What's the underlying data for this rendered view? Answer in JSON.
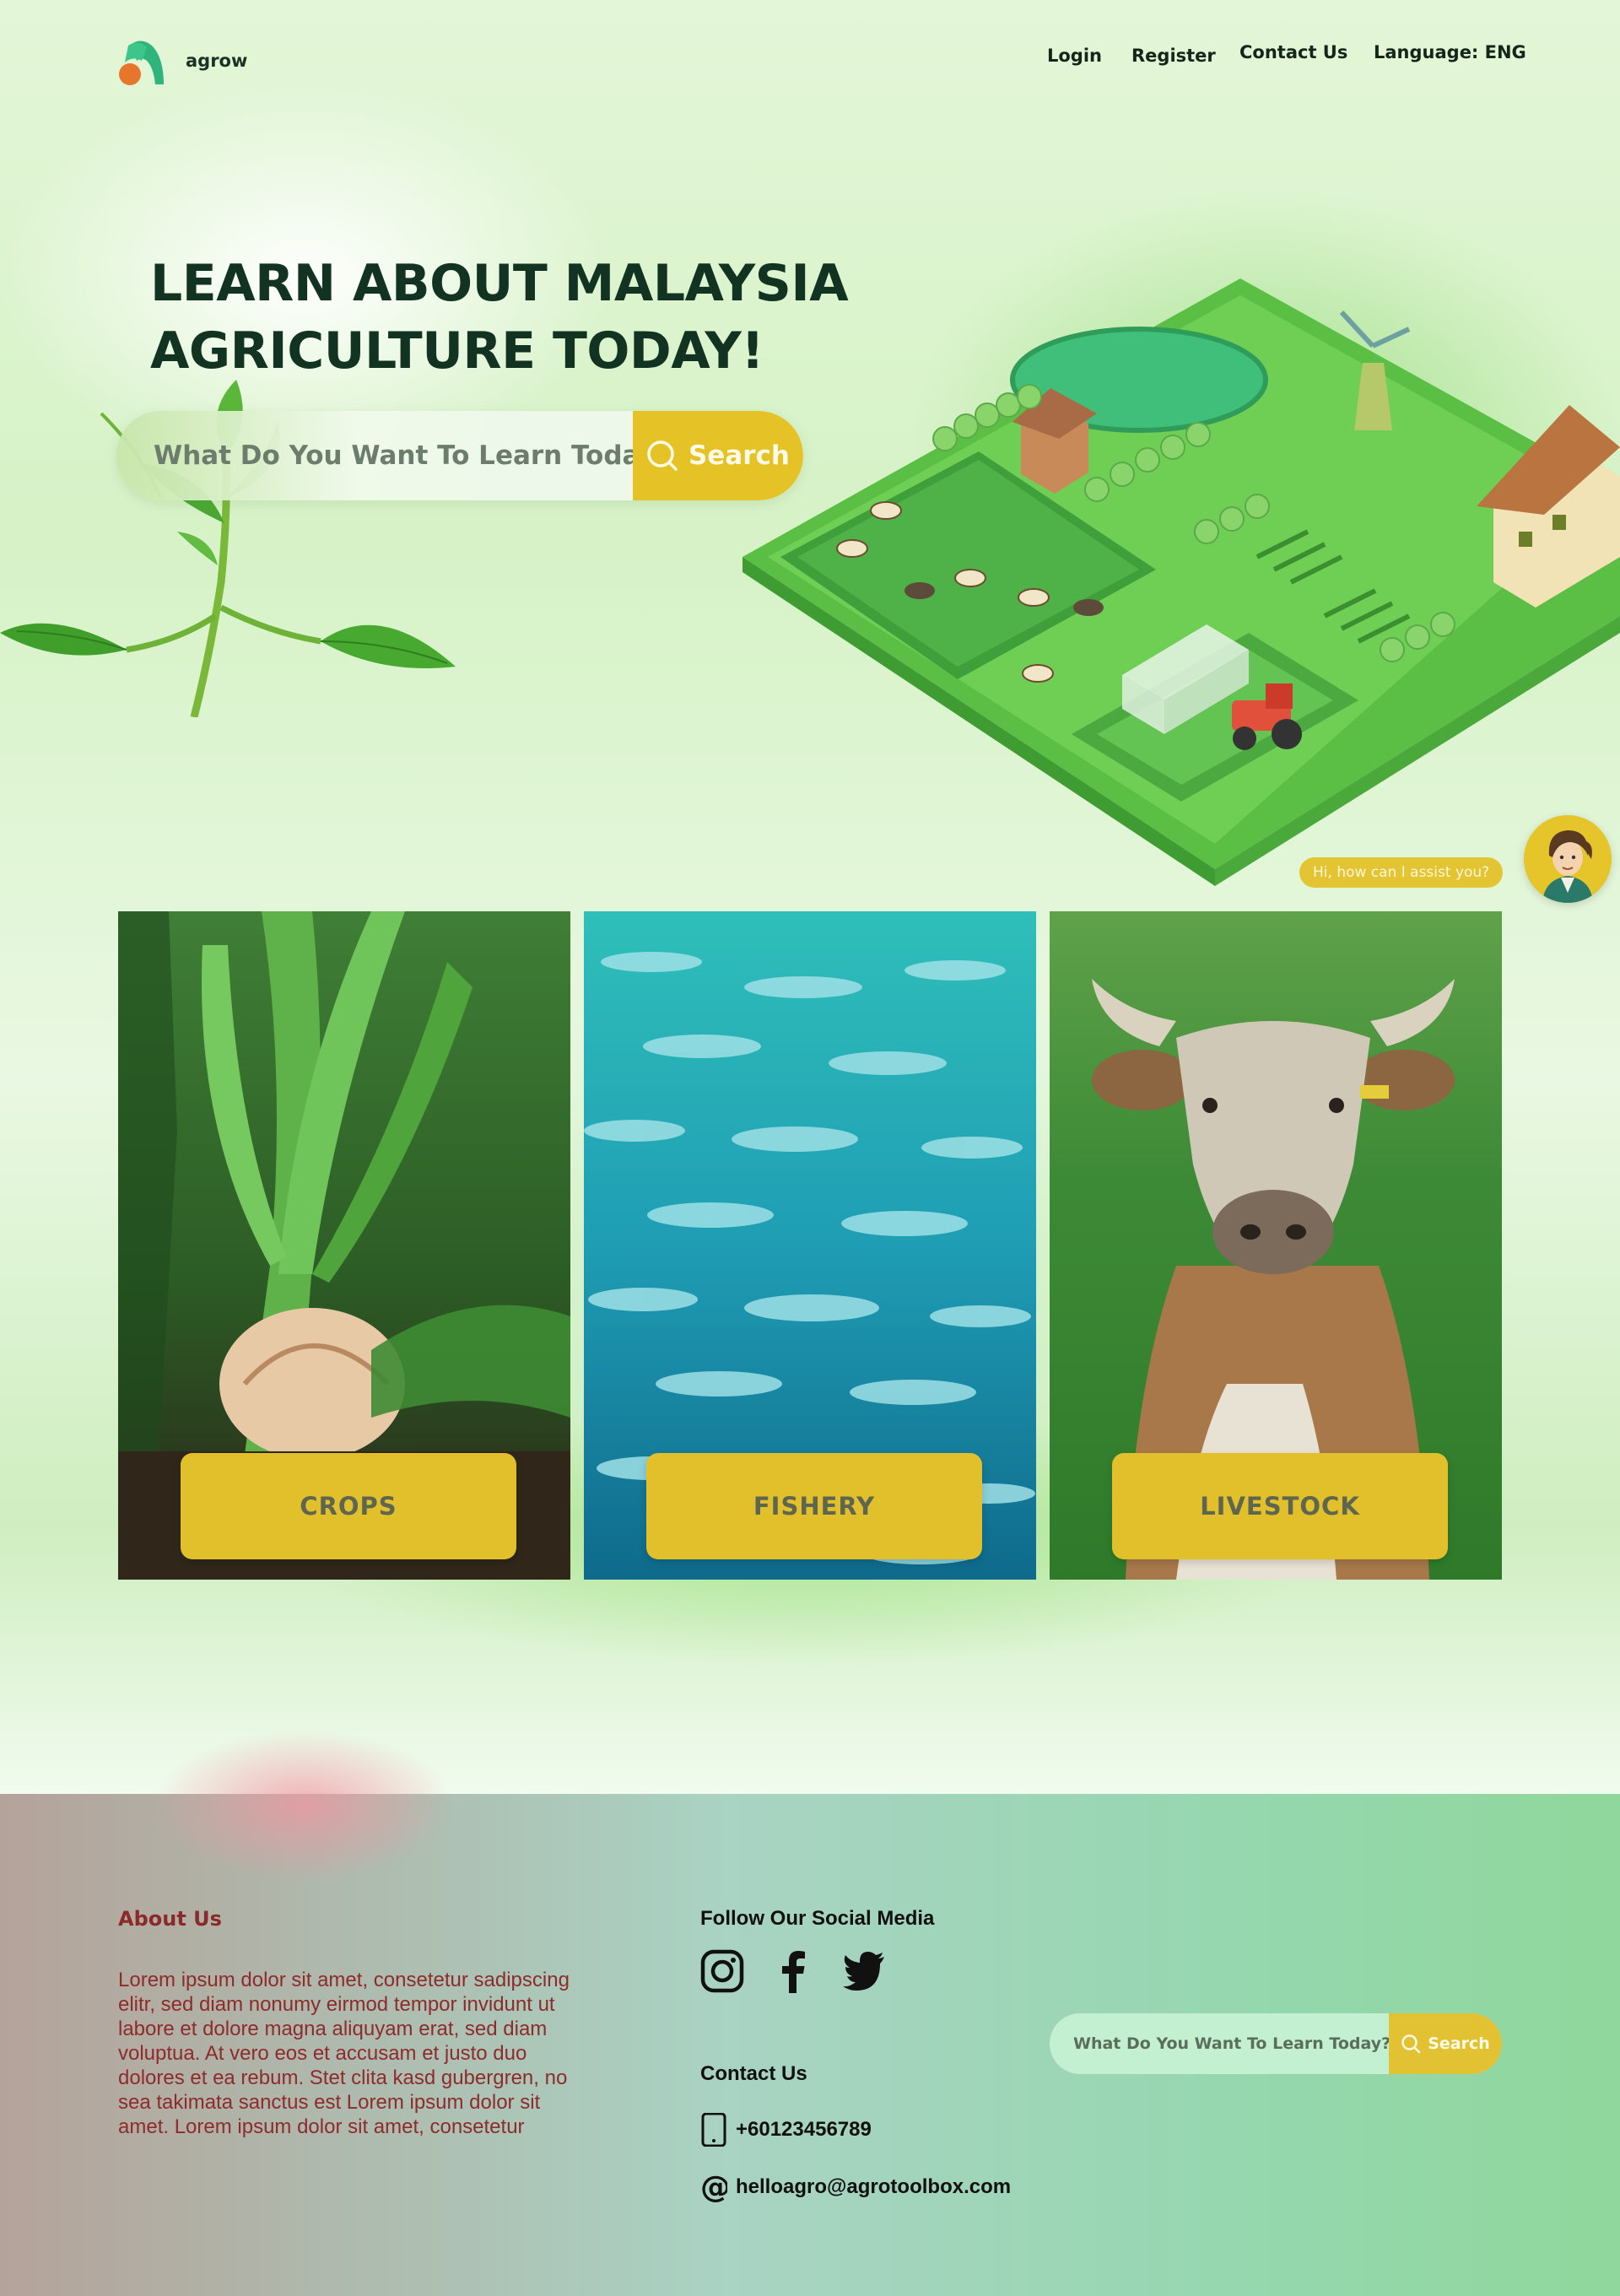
{
  "header": {
    "brand": "agrow",
    "nav": {
      "login": "Login",
      "register": "Register",
      "contact": "Contact Us",
      "language": "Language: ENG"
    }
  },
  "hero": {
    "title_line1": "LEARN ABOUT MALAYSIA",
    "title_line2": "AGRICULTURE TODAY!",
    "search": {
      "placeholder": "What Do You Want To Learn Today?",
      "button_label": "Search"
    }
  },
  "chatbot": {
    "greeting": "Hi, how can I assist you?"
  },
  "categories": [
    {
      "label": "CROPS"
    },
    {
      "label": "FISHERY"
    },
    {
      "label": "LIVESTOCK"
    }
  ],
  "footer": {
    "about_title": "About Us",
    "about_text": "Lorem ipsum dolor sit amet, consetetur sadipscing elitr, sed diam nonumy eirmod tempor invidunt ut labore et dolore magna aliquyam erat, sed diam voluptua. At vero eos et accusam et justo duo dolores et ea rebum. Stet clita kasd gubergren, no sea takimata sanctus est Lorem ipsum dolor sit amet. Lorem ipsum dolor sit amet, consetetur",
    "social_title": "Follow Our Social Media",
    "social_icons": [
      "instagram-icon",
      "facebook-icon",
      "twitter-icon"
    ],
    "contact_title": "Contact Us",
    "phone": "+60123456789",
    "email": "helloagro@agrotoolbox.com",
    "search": {
      "placeholder": "What Do You Want To Learn Today?",
      "button_label": "Search"
    }
  },
  "colors": {
    "accent_yellow": "#e5c226",
    "brand_green": "#2fb57b",
    "brand_orange": "#e6762c",
    "title_green": "#123322",
    "about_red": "#8e2b2b"
  }
}
